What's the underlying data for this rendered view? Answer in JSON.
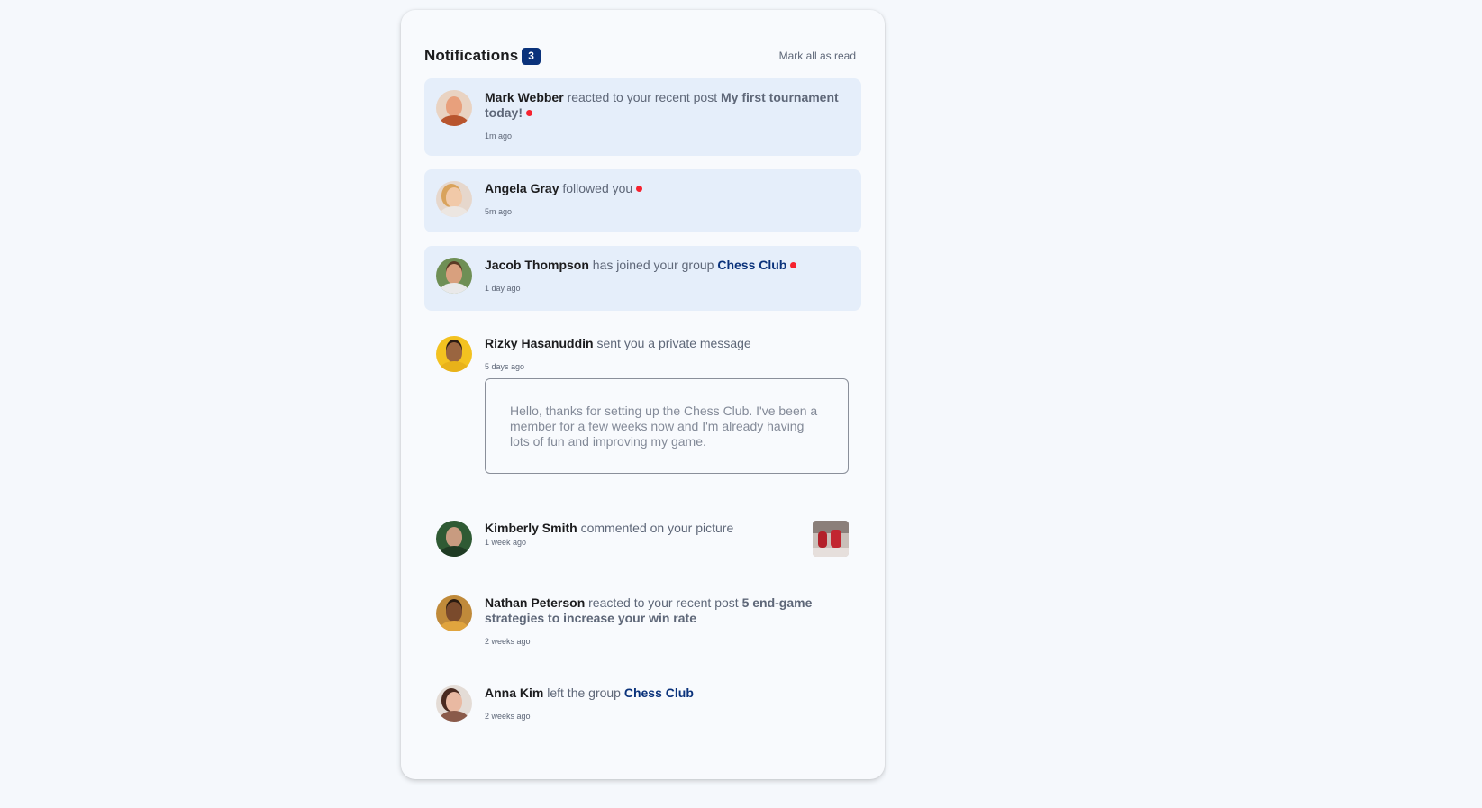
{
  "header": {
    "title": "Notifications",
    "unread_count": "3",
    "mark_all_label": "Mark all as read"
  },
  "notifications": [
    {
      "user": "Mark Webber",
      "action": "reacted to your recent post",
      "target": "My first tournament today!",
      "time": "1m ago",
      "unread": true,
      "avatar_icon": "avatar-mark-webber"
    },
    {
      "user": "Angela Gray",
      "action": "followed you",
      "time": "5m ago",
      "unread": true,
      "avatar_icon": "avatar-angela-gray"
    },
    {
      "user": "Jacob Thompson",
      "action": "has joined your group",
      "target": "Chess Club",
      "time": "1 day ago",
      "unread": true,
      "avatar_icon": "avatar-jacob-thompson"
    },
    {
      "user": "Rizky Hasanuddin",
      "action": "sent you a private message",
      "time": "5 days ago",
      "unread": false,
      "message": "Hello, thanks for setting up the Chess Club. I've been a member for a few weeks now and I'm already having lots of fun and improving my game.",
      "avatar_icon": "avatar-rizky-hasanuddin"
    },
    {
      "user": "Kimberly Smith",
      "action": "commented on your picture",
      "time": "1 week ago",
      "unread": false,
      "avatar_icon": "avatar-kimberly-smith",
      "picture_icon": "chess-picture-thumbnail"
    },
    {
      "user": "Nathan Peterson",
      "action": "reacted to your recent post",
      "target": "5 end-game strategies to increase your win rate",
      "time": "2 weeks ago",
      "unread": false,
      "avatar_icon": "avatar-nathan-peterson"
    },
    {
      "user": "Anna Kim",
      "action": "left the group",
      "target": "Chess Club",
      "time": "2 weeks ago",
      "unread": false,
      "avatar_icon": "avatar-anna-kim"
    }
  ],
  "colors": {
    "unread_background": "#e5eefa",
    "badge_background": "#0a327b",
    "unread_dot": "#f6222f",
    "group_link": "#0a327b"
  }
}
